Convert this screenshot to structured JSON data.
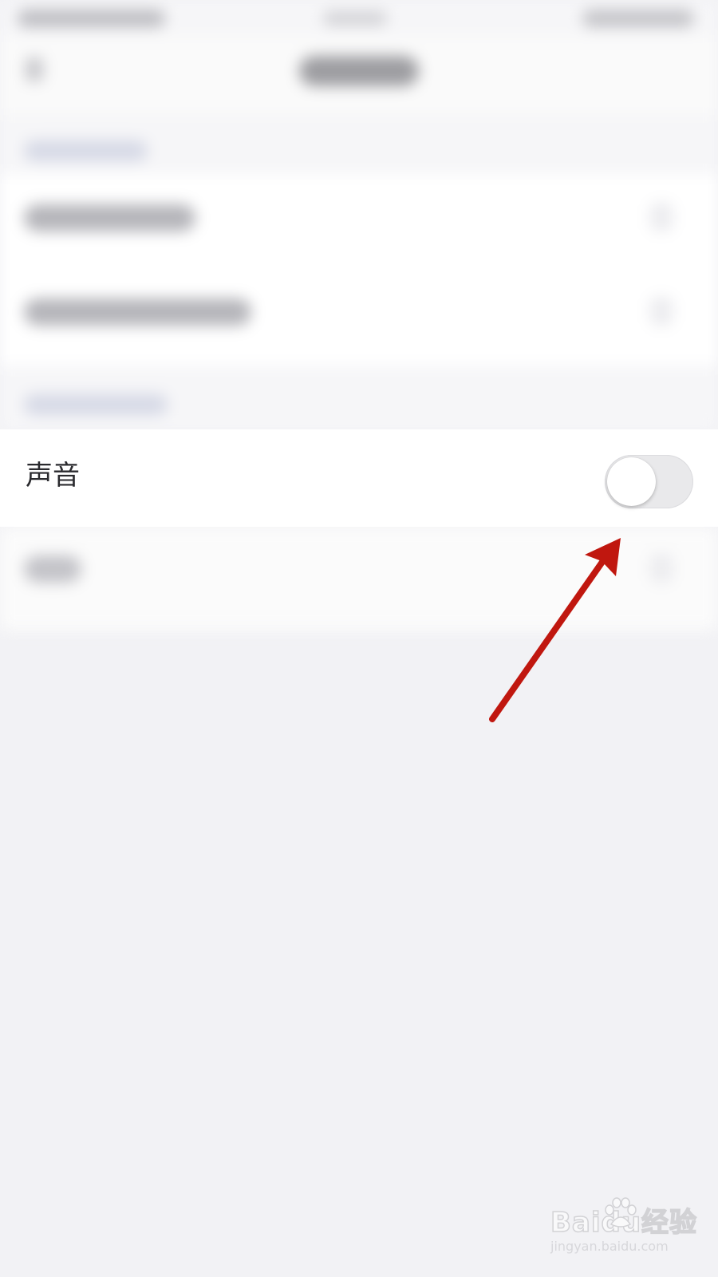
{
  "sound_row": {
    "label": "声音",
    "toggle_on": false
  },
  "watermark": {
    "logo_text": "Baidu经验",
    "url": "jingyan.baidu.com"
  },
  "colors": {
    "background": "#f2f2f5",
    "toggle_track_off": "#e9e9eb",
    "arrow": "#c0170f"
  }
}
